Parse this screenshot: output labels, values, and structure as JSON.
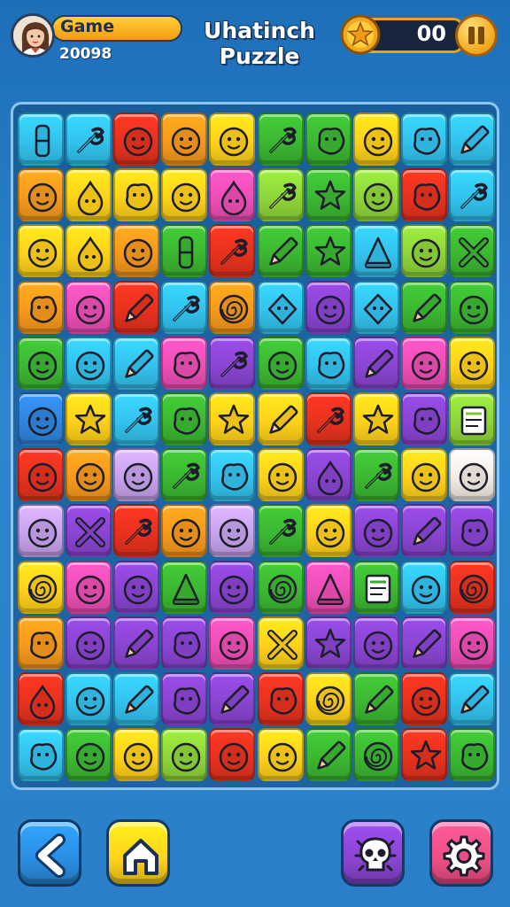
{
  "header": {
    "player_name": "Game",
    "player_score": "20098",
    "title_line1": "Uhatinch",
    "title_line2": "Puzzle",
    "coins": "00"
  },
  "palette": {
    "cyan": "#33c3ee",
    "yellow": "#ffd21a",
    "red": "#e8321e",
    "orange": "#f79a1c",
    "green": "#3cb832",
    "lime": "#8fd63a",
    "purple": "#8a45d2",
    "pink": "#ee4fb6",
    "blue": "#2f86e0",
    "lavender": "#c8a3ee",
    "white": "#f4ede4"
  },
  "board": {
    "columns": 10,
    "rows": 12,
    "tiles": [
      [
        [
          "cyan",
          "pill"
        ],
        [
          "cyan",
          "tool"
        ],
        [
          "red",
          "face"
        ],
        [
          "orange",
          "face"
        ],
        [
          "yellow",
          "face"
        ],
        [
          "green",
          "tool"
        ],
        [
          "green",
          "blob"
        ],
        [
          "yellow",
          "face"
        ],
        [
          "cyan",
          "blob"
        ],
        [
          "cyan",
          "pencil"
        ]
      ],
      [
        [
          "orange",
          "face"
        ],
        [
          "yellow",
          "drop"
        ],
        [
          "yellow",
          "blob"
        ],
        [
          "yellow",
          "face"
        ],
        [
          "pink",
          "drop"
        ],
        [
          "lime",
          "tool"
        ],
        [
          "green",
          "star"
        ],
        [
          "lime",
          "face"
        ],
        [
          "red",
          "blob"
        ],
        [
          "cyan",
          "tool"
        ]
      ],
      [
        [
          "yellow",
          "face"
        ],
        [
          "yellow",
          "drop"
        ],
        [
          "orange",
          "face"
        ],
        [
          "green",
          "pill"
        ],
        [
          "red",
          "tool"
        ],
        [
          "green",
          "pencil"
        ],
        [
          "green",
          "star"
        ],
        [
          "cyan",
          "cone"
        ],
        [
          "lime",
          "face"
        ],
        [
          "green",
          "cross"
        ]
      ],
      [
        [
          "orange",
          "blob"
        ],
        [
          "pink",
          "face"
        ],
        [
          "red",
          "pencil"
        ],
        [
          "cyan",
          "tool"
        ],
        [
          "orange",
          "spiral"
        ],
        [
          "cyan",
          "diamond"
        ],
        [
          "purple",
          "face"
        ],
        [
          "cyan",
          "diamond"
        ],
        [
          "green",
          "pencil"
        ],
        [
          "green",
          "face"
        ]
      ],
      [
        [
          "green",
          "face"
        ],
        [
          "cyan",
          "face"
        ],
        [
          "cyan",
          "pencil"
        ],
        [
          "pink",
          "blob"
        ],
        [
          "purple",
          "tool"
        ],
        [
          "green",
          "face"
        ],
        [
          "cyan",
          "blob"
        ],
        [
          "purple",
          "pencil"
        ],
        [
          "pink",
          "face"
        ],
        [
          "yellow",
          "face"
        ]
      ],
      [
        [
          "blue",
          "face"
        ],
        [
          "yellow",
          "star"
        ],
        [
          "cyan",
          "tool"
        ],
        [
          "green",
          "blob"
        ],
        [
          "yellow",
          "star"
        ],
        [
          "yellow",
          "pencil"
        ],
        [
          "red",
          "tool"
        ],
        [
          "yellow",
          "star"
        ],
        [
          "purple",
          "blob"
        ],
        [
          "lime",
          "card"
        ]
      ],
      [
        [
          "red",
          "face"
        ],
        [
          "orange",
          "face"
        ],
        [
          "lavender",
          "face"
        ],
        [
          "green",
          "tool"
        ],
        [
          "cyan",
          "blob"
        ],
        [
          "yellow",
          "face"
        ],
        [
          "purple",
          "drop"
        ],
        [
          "green",
          "tool"
        ],
        [
          "yellow",
          "face"
        ],
        [
          "white",
          "face"
        ]
      ],
      [
        [
          "lavender",
          "face"
        ],
        [
          "purple",
          "cross"
        ],
        [
          "red",
          "tool"
        ],
        [
          "orange",
          "face"
        ],
        [
          "lavender",
          "face"
        ],
        [
          "green",
          "tool"
        ],
        [
          "yellow",
          "face"
        ],
        [
          "purple",
          "face"
        ],
        [
          "purple",
          "pencil"
        ],
        [
          "purple",
          "blob"
        ]
      ],
      [
        [
          "yellow",
          "spiral"
        ],
        [
          "pink",
          "face"
        ],
        [
          "purple",
          "face"
        ],
        [
          "green",
          "cone"
        ],
        [
          "purple",
          "face"
        ],
        [
          "green",
          "spiral"
        ],
        [
          "pink",
          "cone"
        ],
        [
          "green",
          "card"
        ],
        [
          "cyan",
          "face"
        ],
        [
          "red",
          "spiral"
        ]
      ],
      [
        [
          "orange",
          "blob"
        ],
        [
          "purple",
          "face"
        ],
        [
          "purple",
          "pencil"
        ],
        [
          "purple",
          "blob"
        ],
        [
          "pink",
          "face"
        ],
        [
          "yellow",
          "cross"
        ],
        [
          "purple",
          "star"
        ],
        [
          "purple",
          "face"
        ],
        [
          "purple",
          "pencil"
        ],
        [
          "pink",
          "face"
        ]
      ],
      [
        [
          "red",
          "drop"
        ],
        [
          "cyan",
          "face"
        ],
        [
          "cyan",
          "pencil"
        ],
        [
          "purple",
          "blob"
        ],
        [
          "purple",
          "pencil"
        ],
        [
          "red",
          "blob"
        ],
        [
          "yellow",
          "spiral"
        ],
        [
          "green",
          "pencil"
        ],
        [
          "red",
          "face"
        ],
        [
          "cyan",
          "pencil"
        ]
      ],
      [
        [
          "cyan",
          "blob"
        ],
        [
          "green",
          "face"
        ],
        [
          "yellow",
          "face"
        ],
        [
          "lime",
          "face"
        ],
        [
          "red",
          "face"
        ],
        [
          "yellow",
          "face"
        ],
        [
          "green",
          "pencil"
        ],
        [
          "green",
          "spiral"
        ],
        [
          "red",
          "star"
        ],
        [
          "green",
          "blob"
        ]
      ]
    ]
  },
  "bottom_buttons": [
    {
      "name": "back-button",
      "icon": "back-arrow-icon",
      "color": "#2b8fe3"
    },
    {
      "name": "home-button",
      "icon": "home-icon",
      "color": "#ffd21a"
    },
    {
      "name": "skull-button",
      "icon": "skull-icon",
      "color": "#8a45d2"
    },
    {
      "name": "settings-button",
      "icon": "gear-icon",
      "color": "#ee4f86"
    }
  ]
}
